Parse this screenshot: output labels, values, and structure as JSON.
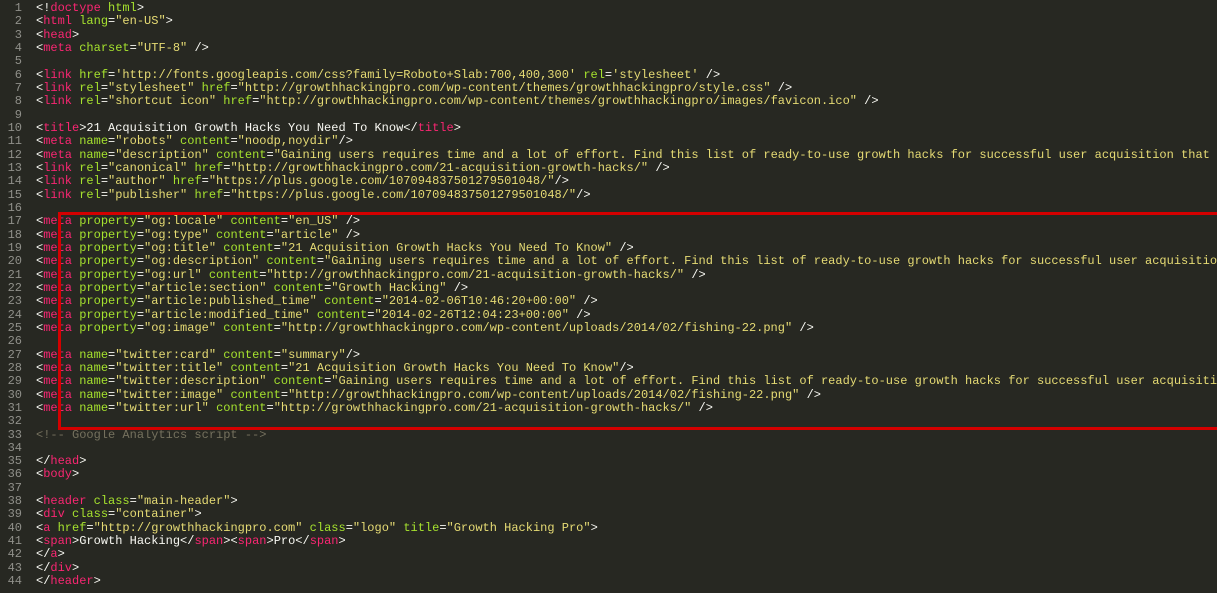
{
  "editor": {
    "lineStart": 1,
    "lineEnd": 44,
    "highlight": {
      "fromLine": 17,
      "toLine": 32
    }
  },
  "code": {
    "l1": "<!doctype html>",
    "l2": {
      "pre": "<",
      "tag": "html",
      "attrs": [
        {
          "n": "lang",
          "v": "en-US"
        }
      ],
      "post": ">"
    },
    "l3": {
      "pre": "<",
      "tag": "head",
      "post": ">"
    },
    "l4": {
      "indent": "    ",
      "pre": "<",
      "tag": "meta",
      "attrs": [
        {
          "n": "charset",
          "v": "UTF-8"
        }
      ],
      "post": " />"
    },
    "l5": "",
    "l6": {
      "indent": "    ",
      "pre": "<",
      "tag": "link",
      "attrs": [
        {
          "n": "href",
          "v": "http://fonts.googleapis.com/css?family=Roboto+Slab:700,400,300",
          "q": "'"
        },
        {
          "n": "rel",
          "v": "stylesheet",
          "q": "'"
        }
      ],
      "post": " />"
    },
    "l7": {
      "indent": "    ",
      "pre": "<",
      "tag": "link",
      "attrs": [
        {
          "n": "rel",
          "v": "stylesheet"
        },
        {
          "n": "href",
          "v": "http://growthhackingpro.com/wp-content/themes/growthhackingpro/style.css"
        }
      ],
      "post": " />"
    },
    "l8": {
      "indent": "    ",
      "pre": "<",
      "tag": "link",
      "attrs": [
        {
          "n": "rel",
          "v": "shortcut icon"
        },
        {
          "n": "href",
          "v": "http://growthhackingpro.com/wp-content/themes/growthhackingpro/images/favicon.ico"
        }
      ],
      "post": " />"
    },
    "l9": "",
    "l10": {
      "pre": "<",
      "tag": "title",
      "text": "21 Acquisition Growth Hacks You Need To Know",
      "close": "title"
    },
    "l11": {
      "pre": "<",
      "tag": "meta",
      "attrs": [
        {
          "n": "name",
          "v": "robots"
        },
        {
          "n": "content",
          "v": "noodp,noydir"
        }
      ],
      "post": "/>"
    },
    "l12": {
      "pre": "<",
      "tag": "meta",
      "attrs": [
        {
          "n": "name",
          "v": "description"
        },
        {
          "n": "content",
          "v": "Gaining users requires time and a lot of effort. Find this list of ready-to-use growth hacks for successful user acquisition that will help."
        }
      ],
      "post": "/>"
    },
    "l13": {
      "pre": "<",
      "tag": "link",
      "attrs": [
        {
          "n": "rel",
          "v": "canonical"
        },
        {
          "n": "href",
          "v": "http://growthhackingpro.com/21-acquisition-growth-hacks/"
        }
      ],
      "post": " />"
    },
    "l14": {
      "pre": "<",
      "tag": "link",
      "attrs": [
        {
          "n": "rel",
          "v": "author"
        },
        {
          "n": "href",
          "v": "https://plus.google.com/107094837501279501048/"
        }
      ],
      "post": "/>"
    },
    "l15": {
      "pre": "<",
      "tag": "link",
      "attrs": [
        {
          "n": "rel",
          "v": "publisher"
        },
        {
          "n": "href",
          "v": "https://plus.google.com/107094837501279501048/"
        }
      ],
      "post": "/>"
    },
    "l16": "",
    "l17": {
      "pre": "<",
      "tag": "meta",
      "attrs": [
        {
          "n": "property",
          "v": "og:locale"
        },
        {
          "n": "content",
          "v": "en_US"
        }
      ],
      "post": " />"
    },
    "l18": {
      "pre": "<",
      "tag": "meta",
      "attrs": [
        {
          "n": "property",
          "v": "og:type"
        },
        {
          "n": "content",
          "v": "article"
        }
      ],
      "post": " />"
    },
    "l19": {
      "pre": "<",
      "tag": "meta",
      "attrs": [
        {
          "n": "property",
          "v": "og:title"
        },
        {
          "n": "content",
          "v": "21 Acquisition Growth Hacks You Need To Know"
        }
      ],
      "post": " />"
    },
    "l20": {
      "pre": "<",
      "tag": "meta",
      "attrs": [
        {
          "n": "property",
          "v": "og:description"
        },
        {
          "n": "content",
          "v": "Gaining users requires time and a lot of effort. Find this list of ready-to-use growth hacks for successful user acquisition that will help."
        }
      ],
      "post": " />"
    },
    "l21": {
      "pre": "<",
      "tag": "meta",
      "attrs": [
        {
          "n": "property",
          "v": "og:url"
        },
        {
          "n": "content",
          "v": "http://growthhackingpro.com/21-acquisition-growth-hacks/"
        }
      ],
      "post": " />"
    },
    "l22": {
      "pre": "<",
      "tag": "meta",
      "attrs": [
        {
          "n": "property",
          "v": "article:section"
        },
        {
          "n": "content",
          "v": "Growth Hacking"
        }
      ],
      "post": " />"
    },
    "l23": {
      "pre": "<",
      "tag": "meta",
      "attrs": [
        {
          "n": "property",
          "v": "article:published_time"
        },
        {
          "n": "content",
          "v": "2014-02-06T10:46:20+00:00"
        }
      ],
      "post": " />"
    },
    "l24": {
      "pre": "<",
      "tag": "meta",
      "attrs": [
        {
          "n": "property",
          "v": "article:modified_time"
        },
        {
          "n": "content",
          "v": "2014-02-26T12:04:23+00:00"
        }
      ],
      "post": " />"
    },
    "l25": {
      "pre": "<",
      "tag": "meta",
      "attrs": [
        {
          "n": "property",
          "v": "og:image"
        },
        {
          "n": "content",
          "v": "http://growthhackingpro.com/wp-content/uploads/2014/02/fishing-22.png"
        }
      ],
      "post": " />"
    },
    "l26": "",
    "l27": {
      "pre": "<",
      "tag": "meta",
      "attrs": [
        {
          "n": "name",
          "v": "twitter:card"
        },
        {
          "n": "content",
          "v": "summary"
        }
      ],
      "post": "/>"
    },
    "l28": {
      "pre": "<",
      "tag": "meta",
      "attrs": [
        {
          "n": "name",
          "v": "twitter:title"
        },
        {
          "n": "content",
          "v": "21 Acquisition Growth Hacks You Need To Know"
        }
      ],
      "post": "/>"
    },
    "l29": {
      "pre": "<",
      "tag": "meta",
      "attrs": [
        {
          "n": "name",
          "v": "twitter:description"
        },
        {
          "n": "content",
          "v": "Gaining users requires time and a lot of effort. Find this list of ready-to-use growth hacks for successful user acquisition that will help."
        }
      ],
      "post": " />"
    },
    "l30": {
      "pre": "<",
      "tag": "meta",
      "attrs": [
        {
          "n": "name",
          "v": "twitter:image"
        },
        {
          "n": "content",
          "v": "http://growthhackingpro.com/wp-content/uploads/2014/02/fishing-22.png"
        }
      ],
      "post": " />"
    },
    "l31": {
      "pre": "<",
      "tag": "meta",
      "attrs": [
        {
          "n": "name",
          "v": "twitter:url"
        },
        {
          "n": "content",
          "v": "http://growthhackingpro.com/21-acquisition-growth-hacks/"
        }
      ],
      "post": " />"
    },
    "l32": "",
    "l33_comment": "<!-- Google Analytics script -->",
    "l34": "",
    "l35": {
      "indent": "  ",
      "closeTag": "head"
    },
    "l36": {
      "indent": "  ",
      "pre": "<",
      "tag": "body",
      "post": ">"
    },
    "l37": "",
    "l38": {
      "indent": "    ",
      "pre": "<",
      "tag": "header",
      "attrs": [
        {
          "n": "class",
          "v": "main-header"
        }
      ],
      "post": ">"
    },
    "l39": {
      "indent": "      ",
      "pre": "<",
      "tag": "div",
      "attrs": [
        {
          "n": "class",
          "v": "container"
        }
      ],
      "post": ">"
    },
    "l40": {
      "indent": "        ",
      "pre": "<",
      "tag": "a",
      "attrs": [
        {
          "n": "href",
          "v": "http://growthhackingpro.com"
        },
        {
          "n": "class",
          "v": "logo"
        },
        {
          "n": "title",
          "v": "Growth Hacking Pro"
        }
      ],
      "post": ">"
    },
    "l41": {
      "indent": "          ",
      "spans": [
        {
          "t": "Growth Hacking"
        },
        {
          "t": "Pro"
        }
      ]
    },
    "l42": {
      "indent": "        ",
      "closeTag": "a"
    },
    "l43": {
      "indent": "      ",
      "closeTag": "div"
    },
    "l44": {
      "indent": "    ",
      "closeTag": "header"
    }
  }
}
